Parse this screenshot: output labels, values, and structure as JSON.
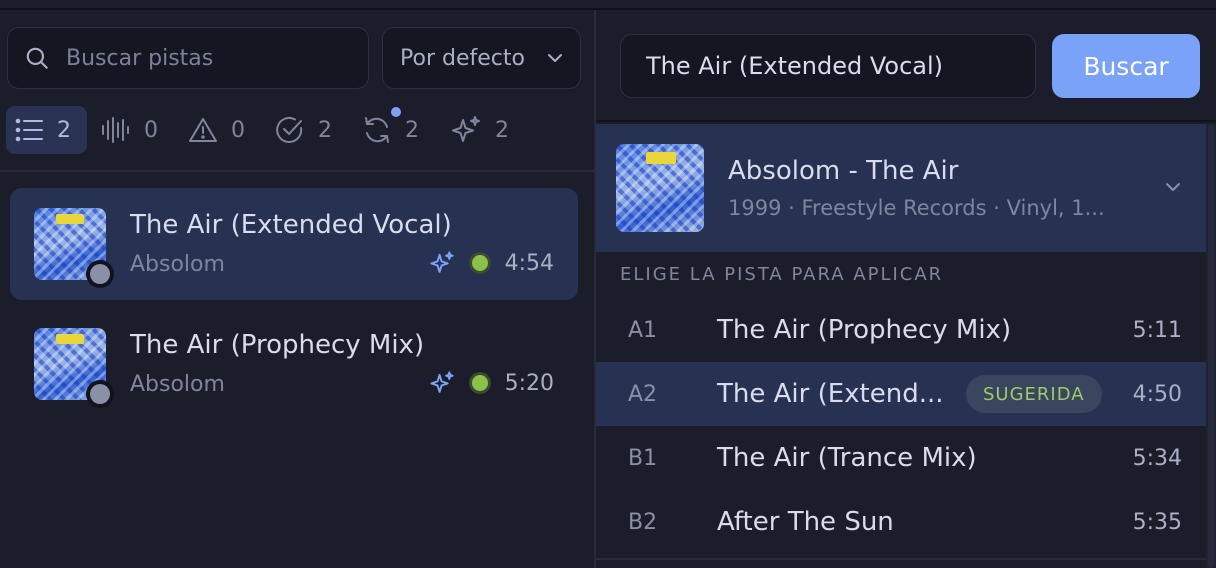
{
  "search": {
    "placeholder": "Buscar pistas"
  },
  "sort": {
    "selected": "Por defecto"
  },
  "filters": [
    {
      "icon": "list-icon",
      "count": "2"
    },
    {
      "icon": "waveform-icon",
      "count": "0"
    },
    {
      "icon": "warning-icon",
      "count": "0"
    },
    {
      "icon": "check-circle-icon",
      "count": "2"
    },
    {
      "icon": "refresh-icon",
      "count": "2"
    },
    {
      "icon": "sparkles-icon",
      "count": "2"
    }
  ],
  "tracks": [
    {
      "title": "The Air (Extended Vocal)",
      "artist": "Absolom",
      "duration": "4:54"
    },
    {
      "title": "The Air (Prophecy Mix)",
      "artist": "Absolom",
      "duration": "5:20"
    }
  ],
  "query": {
    "value": "The Air (Extended Vocal)"
  },
  "search_button": "Buscar",
  "release": {
    "title": "Absolom - The Air",
    "subtitle": "1999 · Freestyle Records · Vinyl, 1..."
  },
  "section_label": "ELIGE LA PISTA PARA APLICAR",
  "release_tracks": [
    {
      "pos": "A1",
      "name": "The Air (Prophecy Mix)",
      "duration": "5:11"
    },
    {
      "pos": "A2",
      "name": "The Air (Extend...",
      "duration": "4:50",
      "badge": "SUGERIDA"
    },
    {
      "pos": "B1",
      "name": "The Air (Trance Mix)",
      "duration": "5:34"
    },
    {
      "pos": "B2",
      "name": "After The Sun",
      "duration": "5:35"
    }
  ],
  "colors": {
    "accent": "#7aa2f7",
    "selected_bg": "#273253",
    "status_green": "#8bc34a",
    "badge_text": "#9ccc65"
  }
}
